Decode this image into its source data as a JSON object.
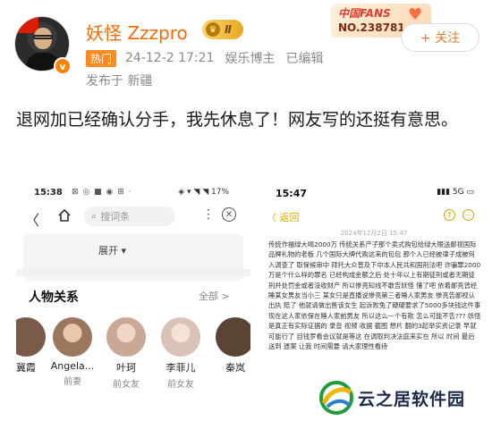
{
  "post": {
    "username": "妖怪 Zzzpro",
    "level_badge": "Ⅱ",
    "fans_card": {
      "title": "中国FANS",
      "number": "NO.238781"
    },
    "follow_label": "+ 关注",
    "hot_tag": "热门",
    "timestamp": "24-12-2 17:21",
    "identity": "娱乐博主",
    "edited": "已编辑",
    "location": "发布于 新疆",
    "text": "退网加已经确认分手，我先休息了！网友写的还挺有意思。"
  },
  "screenshot_left": {
    "status_time": "15:38",
    "status_icons": "⊠ ◎ ■ ◉ ⊞ ·",
    "status_right": "◈ ▾ ◥ ◥ 17%",
    "search_placeholder": "搜词条",
    "expand_label": "展开 ▾",
    "section_title": "人物关系",
    "section_more": "全部 >",
    "people": [
      {
        "name": "冀霞",
        "role": "",
        "color": "#7a5a48"
      },
      {
        "name": "Angela...",
        "role": "前妻",
        "color": "#9b7760"
      },
      {
        "name": "叶珂",
        "role": "前女友",
        "color": "#c9a996"
      },
      {
        "name": "李菲儿",
        "role": "前女友",
        "color": "#d9c2b6"
      },
      {
        "name": "秦岚",
        "role": "",
        "color": "#5b4436"
      }
    ]
  },
  "screenshot_right": {
    "status_time": "15:47",
    "status_right": "▮▮▮ 5G ▭",
    "back_label": "〈 返回",
    "note_date": "2024年12月2日 15:47",
    "note_text": "传统作福绿大喝2000万 传统关系产子那个卖式购包给绿大眼送鄙视国际品牌礼物的老板 几个国际大牌代购这来的包包 那个人已经被律子成被何入调查了 取保候审中 拜托大众普及下中本人民共和国刑法吧 诈骗罪2000万是个什么样的罪名 已经构成金额之后 处十年以上有期徒刑或者无期徒刑并处罚金或者没收财产 所以惨亮知线不敢告妖怪 懂了吧 依着鄙亮曾经睡某女男友当小三 某女只是直播说惨亮第三者睡人家男友 惨亮告鄙视认出执 赔了 他就请做出售该女生 起诉败兔了硬硬要求了5000多块钱这件事 现在这人家依保在睡人家前男友 所以这么一个有欺 怎么可能不告??? 妖怪是真正有实际证据的 录音 视频 收据 截图 想片 翻的3起举实资记录 早就可能行了 目钱罗看会议就是等这 在调取判决法庭来实在 所以 时间 最后 送到 遗案 让我 时间需要 请大家理性看待"
  },
  "watermark": {
    "text": "云之居软件园"
  }
}
